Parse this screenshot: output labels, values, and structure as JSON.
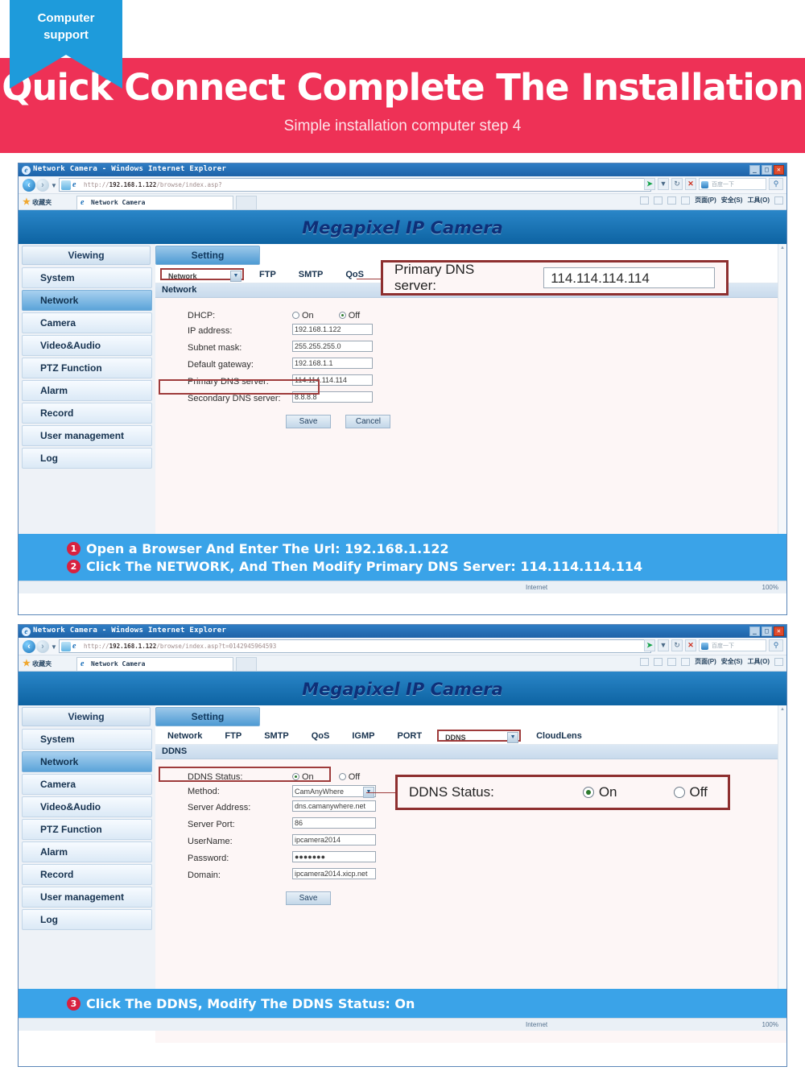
{
  "banner": {
    "badge_line1": "Computer",
    "badge_line2": "support",
    "title": "Quick Connect Complete The Installation",
    "subtitle": "Simple installation computer step 4",
    "pink": "#ee3156",
    "blue": "#1e9bdb"
  },
  "browser": {
    "title": "Network Camera - Windows Internet Explorer",
    "tab_label": "Network Camera",
    "favorites_label": "收藏夹",
    "search_placeholder": "百度一下",
    "minimize": "_",
    "maximize": "□",
    "close": "✕",
    "back_icon": "back-arrow",
    "forward_icon": "forward-arrow",
    "commands": [
      "页面(P)",
      "安全(S)",
      "工具(O)"
    ],
    "status_zone": "Internet",
    "status_zoom": "100%",
    "address1": {
      "prefix": "http://",
      "host": "192.168.1.122",
      "suffix": "/browse/index.asp?"
    },
    "address2": {
      "prefix": "http://",
      "host": "192.168.1.122",
      "suffix": "/browse/index.asp?t=0142945964593"
    }
  },
  "camera": {
    "product_title": "Megapixel IP Camera",
    "mode_tabs": [
      {
        "label": "Viewing",
        "active": false
      },
      {
        "label": "Setting",
        "active": true
      }
    ],
    "sidebar": [
      {
        "label": "System",
        "active": false
      },
      {
        "label": "Network",
        "active": true
      },
      {
        "label": "Camera",
        "active": false
      },
      {
        "label": "Video&Audio",
        "active": false
      },
      {
        "label": "PTZ Function",
        "active": false
      },
      {
        "label": "Alarm",
        "active": false
      },
      {
        "label": "Record",
        "active": false
      },
      {
        "label": "User management",
        "active": false
      },
      {
        "label": "Log",
        "active": false
      }
    ],
    "nav_tabs": [
      "Network",
      "FTP",
      "SMTP",
      "QoS",
      "IGMP",
      "PORT",
      "DDNS",
      "CloudLens"
    ]
  },
  "screen1": {
    "selected_tab": "Network",
    "section_header": "Network",
    "dhcp_label": "DHCP:",
    "dhcp_on": "On",
    "dhcp_off": "Off",
    "dhcp_value": "Off",
    "fields": [
      {
        "label": "IP address:",
        "value": "192.168.1.122"
      },
      {
        "label": "Subnet mask:",
        "value": "255.255.255.0"
      },
      {
        "label": "Default gateway:",
        "value": "192.168.1.1"
      },
      {
        "label": "Primary DNS server:",
        "value": "114.114.114.114"
      },
      {
        "label": "Secondary DNS server:",
        "value": "8.8.8.8"
      }
    ],
    "save_label": "Save",
    "cancel_label": "Cancel",
    "callout": {
      "label": "Primary DNS server:",
      "value": "114.114.114.114"
    },
    "instructions": [
      {
        "num": "1",
        "text": "Open a Browser And Enter The Url: 192.168.1.122"
      },
      {
        "num": "2",
        "text": "Click The NETWORK, And Then Modify Primary DNS Server: 114.114.114.114"
      }
    ]
  },
  "screen2": {
    "selected_tab": "DDNS",
    "section_header": "DDNS",
    "status_label": "DDNS Status:",
    "status_on": "On",
    "status_off": "Off",
    "status_value": "On",
    "fields": [
      {
        "label": "Method:",
        "value": "CamAnyWhere",
        "type": "select"
      },
      {
        "label": "Server Address:",
        "value": "dns.camanywhere.net",
        "type": "text"
      },
      {
        "label": "Server Port:",
        "value": "86",
        "type": "text"
      },
      {
        "label": "UserName:",
        "value": "ipcamera2014",
        "type": "text"
      },
      {
        "label": "Password:",
        "value": "●●●●●●●",
        "type": "password"
      },
      {
        "label": "Domain:",
        "value": "ipcamera2014.xicp.net",
        "type": "text"
      }
    ],
    "save_label": "Save",
    "callout": {
      "label": "DDNS Status:",
      "on": "On",
      "off": "Off"
    },
    "instructions": [
      {
        "num": "3",
        "text": "Click The DDNS, Modify The DDNS Status: On"
      }
    ]
  }
}
